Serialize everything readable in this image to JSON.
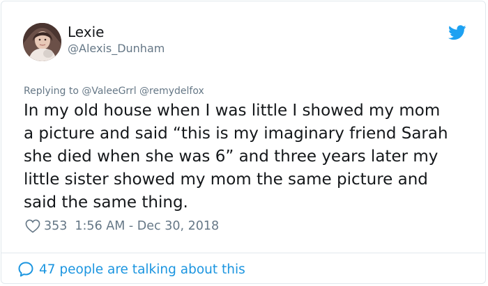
{
  "user": {
    "display_name": "Lexie",
    "handle": "@Alexis_Dunham",
    "avatar_icon": "profile-photo"
  },
  "reply": {
    "prefix": "Replying to",
    "mentions": [
      "@ValeeGrrl",
      "@remydelfox"
    ]
  },
  "tweet": {
    "lines": [
      "In my old house when I was little I showed my mom",
      "a picture and said “this is my imaginary friend Sarah",
      "she died when she was 6” and three years later my",
      "little sister showed my mom the same picture and",
      "said the same thing."
    ]
  },
  "meta": {
    "likes": "353",
    "timestamp": "1:56 AM - Dec 30, 2018"
  },
  "footer": {
    "talking_text": "47 people are talking about this"
  },
  "colors": {
    "text": "#14171a",
    "secondary": "#657786",
    "accent": "#1b95e0",
    "border": "#e1e8ed"
  },
  "icons": {
    "brand": "twitter-bird-icon",
    "like": "heart-icon",
    "conversation": "speech-bubble-icon"
  }
}
